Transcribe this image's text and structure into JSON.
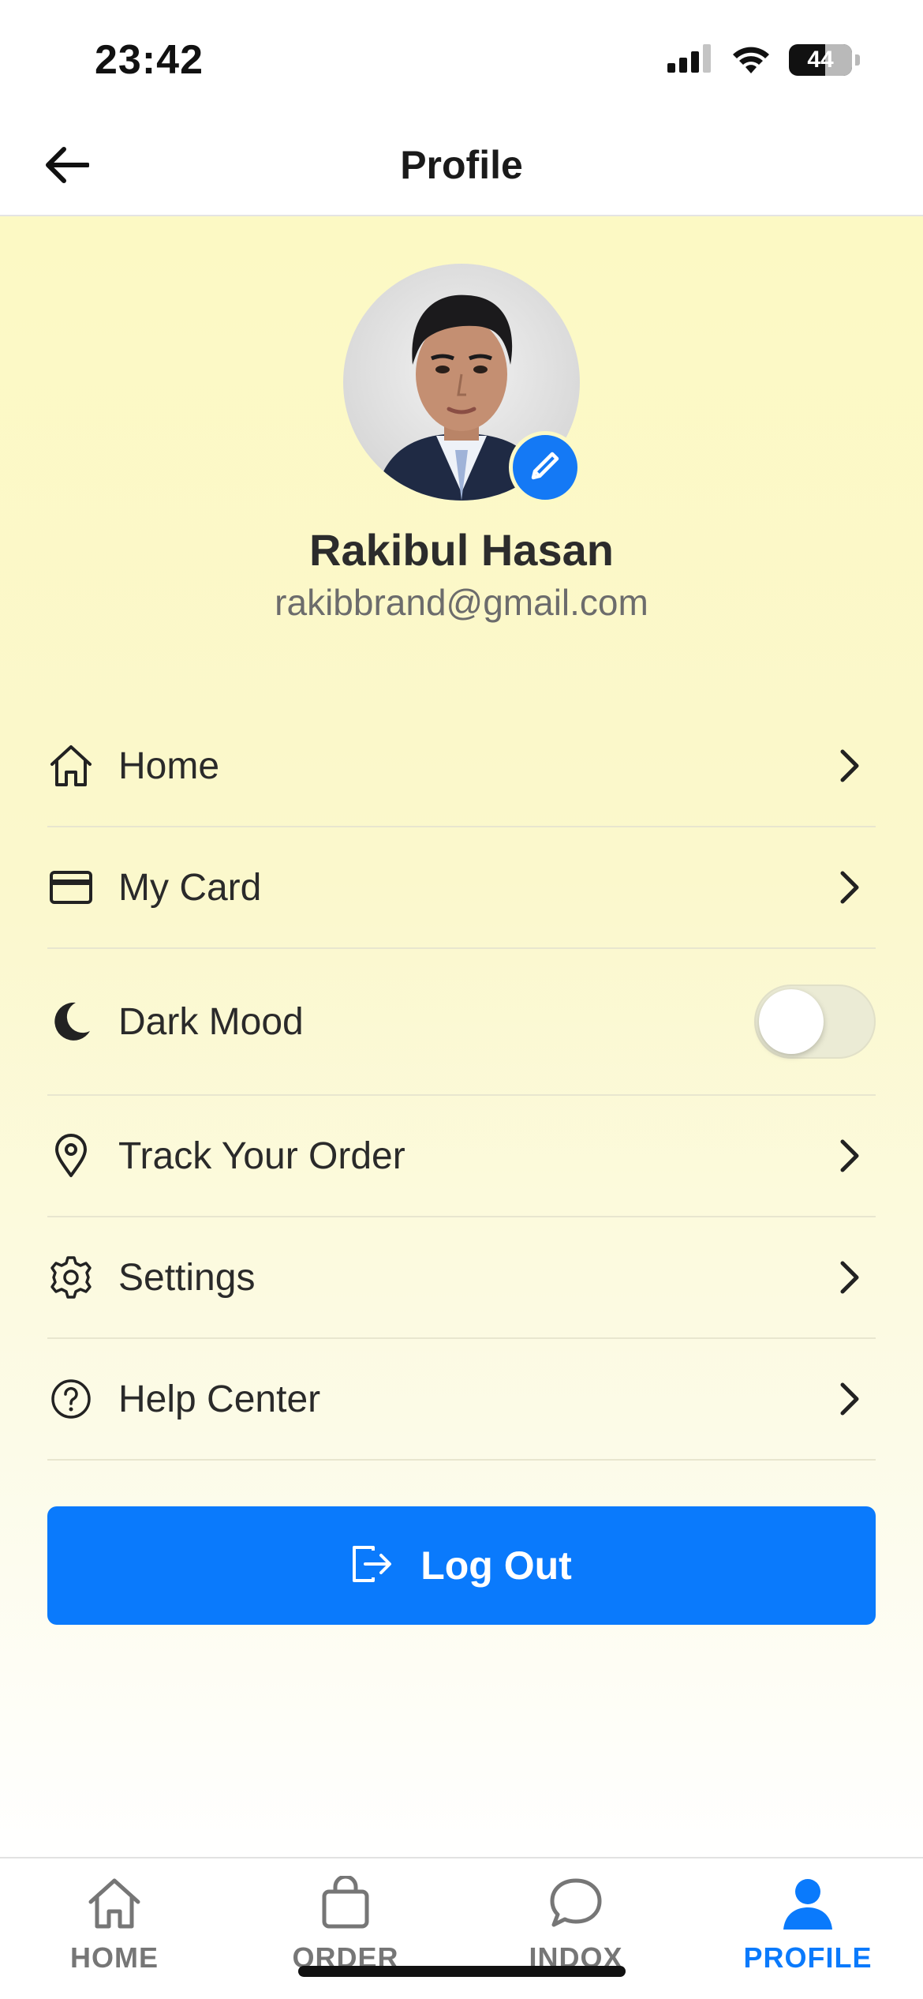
{
  "status_bar": {
    "time": "23:42",
    "battery_level": "44",
    "icons": [
      "signal-icon",
      "wifi-icon",
      "battery-icon"
    ]
  },
  "header": {
    "title": "Profile",
    "back_icon": "arrow-left-icon"
  },
  "profile": {
    "name": "Rakibul Hasan",
    "email": "rakibbrand@gmail.com",
    "edit_icon": "pencil-icon"
  },
  "menu": {
    "items": [
      {
        "label": "Home",
        "icon": "home-icon",
        "type": "link"
      },
      {
        "label": "My Card",
        "icon": "credit-card-icon",
        "type": "link"
      },
      {
        "label": "Dark Mood",
        "icon": "moon-icon",
        "type": "toggle",
        "enabled": false
      },
      {
        "label": "Track Your Order",
        "icon": "location-pin-icon",
        "type": "link"
      },
      {
        "label": "Settings",
        "icon": "gear-icon",
        "type": "link"
      },
      {
        "label": "Help Center",
        "icon": "help-circle-icon",
        "type": "link"
      }
    ]
  },
  "logout": {
    "label": "Log Out",
    "icon": "logout-icon",
    "color": "#0a7afc"
  },
  "tab_bar": {
    "tabs": [
      {
        "label": "HOME",
        "icon": "home-icon",
        "active": false
      },
      {
        "label": "ORDER",
        "icon": "shopping-bag-icon",
        "active": false
      },
      {
        "label": "INDOX",
        "icon": "chat-bubble-icon",
        "active": false
      },
      {
        "label": "PROFILE",
        "icon": "person-icon",
        "active": true
      }
    ],
    "active_color": "#0a7afc",
    "inactive_color": "#767676"
  },
  "colors": {
    "accent": "#0a7afc",
    "background_gradient_top": "#fcf9c4",
    "background_gradient_bottom": "#ffffff"
  }
}
